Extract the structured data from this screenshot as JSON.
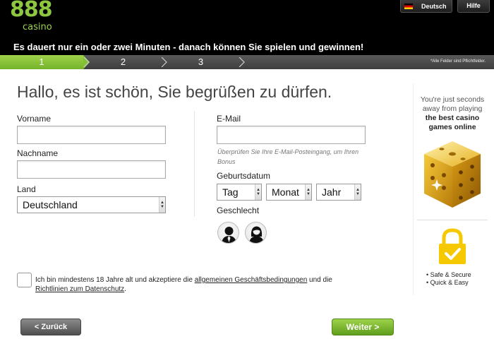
{
  "header": {
    "logo_number": "888",
    "logo_word": "casino",
    "language_label": "Deutsch",
    "help_label": "Hilfe",
    "tagline": "Es dauert nur ein oder zwei Minuten - danach können Sie spielen und gewinnen!"
  },
  "steps": {
    "items": [
      {
        "number": "1",
        "active": true
      },
      {
        "number": "2",
        "active": false
      },
      {
        "number": "3",
        "active": false
      }
    ],
    "required_note": "*Alle Felder sind Pflichtfelder."
  },
  "form": {
    "greeting": "Hallo, es ist schön, Sie begrüßen zu dürfen.",
    "first_name_label": "Vorname",
    "first_name_value": "",
    "last_name_label": "Nachname",
    "last_name_value": "",
    "country_label": "Land",
    "country_value": "Deutschland",
    "email_label": "E-Mail",
    "email_value": "",
    "email_hint": "Überprüfen Sie Ihre E-Mail-Posteingang, um Ihren Bonus",
    "birthdate_label": "Geburtsdatum",
    "day_value": "Tag",
    "month_value": "Monat",
    "year_value": "Jahr",
    "gender_label": "Geschlecht"
  },
  "terms": {
    "text_before": "Ich bin mindestens 18 Jahre alt und akzeptiere die ",
    "terms_link": "allgemeinen Geschäftsbedingungen",
    "text_middle": " und die ",
    "privacy_link": "Richtlinien zum Datenschutz",
    "text_after": "."
  },
  "buttons": {
    "back_label": "< Zurück",
    "next_label": "Weiter >"
  },
  "sidebar": {
    "line1": "You're just seconds",
    "line2": "away from playing",
    "line3": "the best casino",
    "line4": "games online",
    "feature1": "• Safe & Secure",
    "feature2": "• Quick & Easy"
  },
  "colors": {
    "brand_green": "#8dc63f",
    "header_bg": "#000000",
    "steps_bg": "#4a4a4a",
    "dice_gold": "#e0a91c",
    "lock_yellow": "#f5c800"
  },
  "icons": {
    "flag": "german-flag-icon",
    "chevron": "chevron-right-icon",
    "male": "male-avatar-icon",
    "female": "female-avatar-icon",
    "dice": "golden-dice-icon",
    "lock": "padlock-check-icon",
    "select": "dropdown-arrow-icon"
  }
}
